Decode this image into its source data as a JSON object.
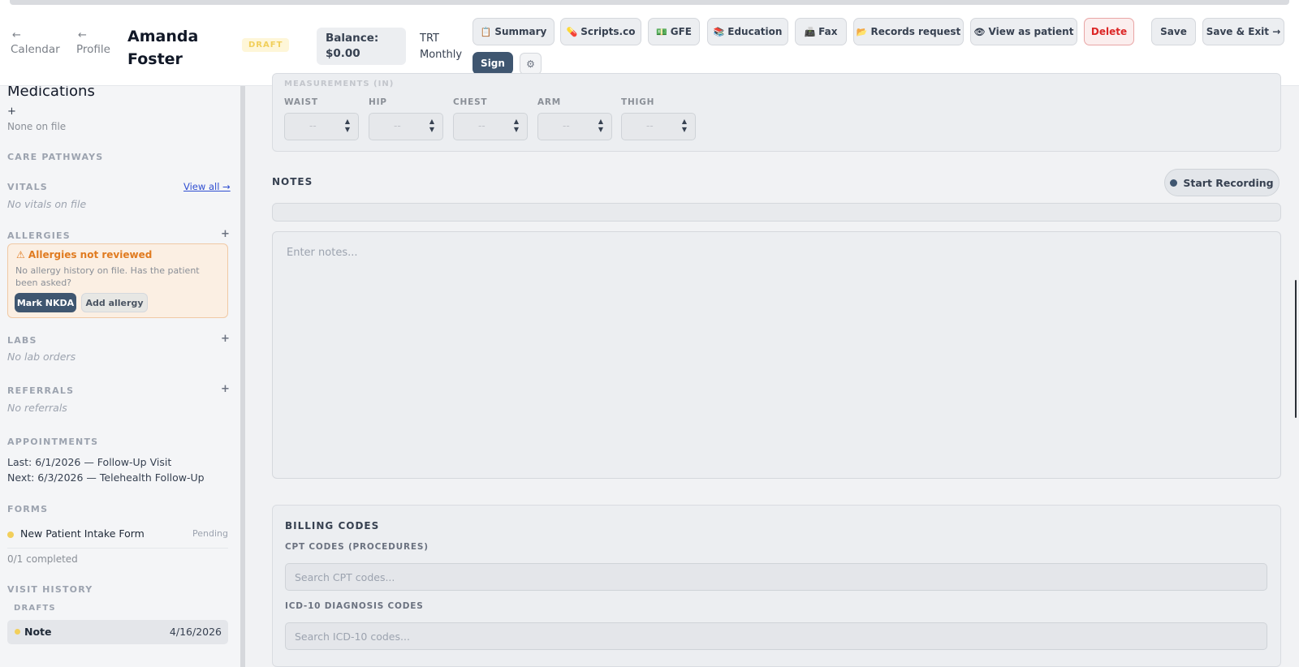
{
  "header": {
    "nav": [
      {
        "arrow": "←",
        "label": "Calendar"
      },
      {
        "arrow": "←",
        "label": "Profile"
      }
    ],
    "patient_name": "Amanda Foster",
    "status_badge": "DRAFT",
    "balance_label": "Balance:",
    "balance_value": "$0.00",
    "plan_line1": "TRT",
    "plan_line2": "Monthly",
    "buttons": [
      {
        "icon": "📋",
        "label": "Summary"
      },
      {
        "icon": "💊",
        "label": "Scripts.co"
      },
      {
        "icon": "💵",
        "label": "GFE"
      },
      {
        "icon": "📚",
        "label": "Education"
      },
      {
        "icon": "📠",
        "label": "Fax"
      },
      {
        "icon": "📂",
        "label": "Records request"
      },
      {
        "icon": "👁",
        "label": "View as patient"
      },
      {
        "label": "Delete"
      },
      {
        "label": "Save"
      },
      {
        "label": "Save & Exit →"
      }
    ],
    "sign_label": "Sign",
    "gear_glyph": "⚙"
  },
  "sidebar": {
    "medications_title": "Medications",
    "medications_plus": "+",
    "medications_empty": "None on file",
    "care_pathways": "CARE PATHWAYS",
    "vitals": "VITALS",
    "vitals_view_all": "View all →",
    "vitals_empty": "No vitals on file",
    "allergies": "ALLERGIES",
    "allergies_plus": "+",
    "allergy_warning": "⚠ Allergies not reviewed",
    "allergy_text": "No allergy history on file. Has the patient been asked?",
    "mark_nkda": "Mark NKDA",
    "add_allergy": "Add allergy",
    "labs": "LABS",
    "labs_plus": "+",
    "labs_empty": "No lab orders",
    "referrals": "REFERRALS",
    "referrals_plus": "+",
    "referrals_empty": "No referrals",
    "appointments": "APPOINTMENTS",
    "appt_last": "Last: 6/1/2026 — Follow-Up Visit",
    "appt_next": "Next: 6/3/2026 — Telehealth Follow-Up",
    "forms": "FORMS",
    "form_name": "New Patient Intake Form",
    "form_status": "Pending",
    "forms_completed": "0/1 completed",
    "visit_history": "VISIT HISTORY",
    "drafts": "DRAFTS",
    "draft_note_name": "Note",
    "draft_note_date": "4/16/2026"
  },
  "measurements": {
    "section_label": "MEASUREMENTS (IN)",
    "fields": [
      {
        "label": "WAIST",
        "value": "--"
      },
      {
        "label": "HIP",
        "value": "--"
      },
      {
        "label": "CHEST",
        "value": "--"
      },
      {
        "label": "ARM",
        "value": "--"
      },
      {
        "label": "THIGH",
        "value": "--"
      }
    ]
  },
  "notes": {
    "heading": "NOTES",
    "record_label": "Start Recording",
    "placeholder": "Enter notes..."
  },
  "billing": {
    "heading": "BILLING CODES",
    "cpt_label": "CPT CODES (PROCEDURES)",
    "cpt_placeholder": "Search CPT codes...",
    "icd_label": "ICD-10 DIAGNOSIS CODES",
    "icd_placeholder": "Search ICD-10 codes..."
  },
  "colors": {
    "primary": "#3f5670",
    "danger": "#dc2626",
    "warning": "#e07b20",
    "draft": "#f1cf5a"
  }
}
